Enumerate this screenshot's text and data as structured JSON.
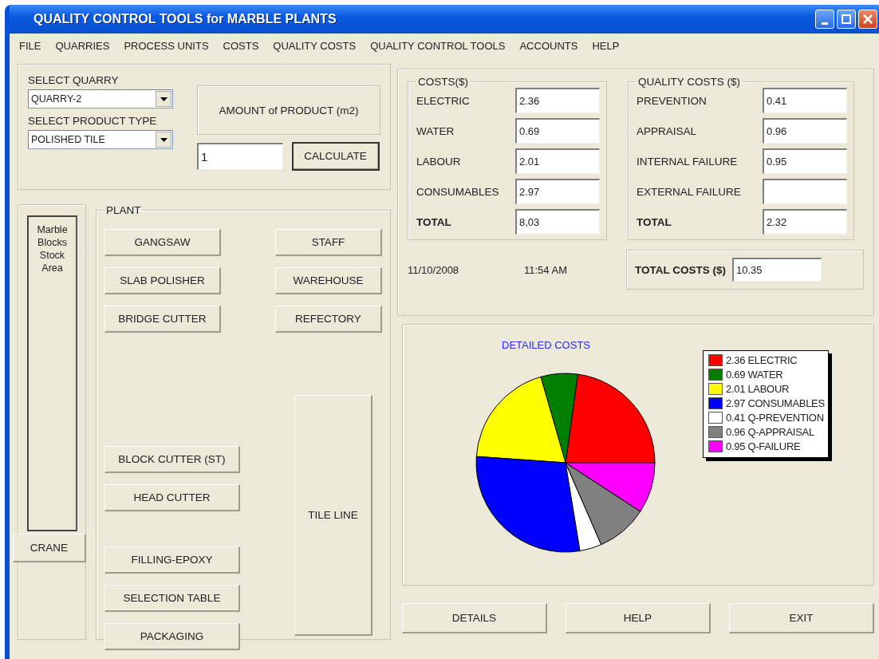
{
  "window": {
    "title": "QUALITY CONTROL TOOLS for MARBLE PLANTS"
  },
  "menu": [
    "FILE",
    "QUARRIES",
    "PROCESS UNITS",
    "COSTS",
    "QUALITY COSTS",
    "QUALITY CONTROL TOOLS",
    "ACCOUNTS",
    "HELP"
  ],
  "selection": {
    "quarry_label": "SELECT QUARRY",
    "quarry": "QUARRY-2",
    "product_label": "SELECT PRODUCT TYPE",
    "product": "POLISHED TILE",
    "amount_label": "AMOUNT of PRODUCT (m2)",
    "amount": "1",
    "calculate": "CALCULATE"
  },
  "stock_area": {
    "label": "Marble Blocks Stock Area",
    "crane": "CRANE"
  },
  "plant": {
    "title": "PLANT",
    "left_groups": [
      [
        "GANGSAW",
        "SLAB POLISHER",
        "BRIDGE CUTTER"
      ],
      [
        "BLOCK CUTTER (ST)",
        "HEAD CUTTER"
      ],
      [
        "FILLING-EPOXY",
        "SELECTION TABLE",
        "PACKAGING"
      ]
    ],
    "right_buttons": [
      "STAFF",
      "WAREHOUSE",
      "REFECTORY"
    ],
    "tile_line": "TILE LINE"
  },
  "costs": {
    "title": "COSTS($)",
    "rows": [
      {
        "label": "ELECTRIC",
        "value": "2.36",
        "bold": false
      },
      {
        "label": "WATER",
        "value": "0.69",
        "bold": false
      },
      {
        "label": "LABOUR",
        "value": "2.01",
        "bold": false
      },
      {
        "label": "CONSUMABLES",
        "value": "2.97",
        "bold": false
      },
      {
        "label": "TOTAL",
        "value": "8,03",
        "bold": true
      }
    ]
  },
  "quality_costs": {
    "title": "QUALITY COSTS ($)",
    "rows": [
      {
        "label": "PREVENTION",
        "value": "0.41",
        "bold": false
      },
      {
        "label": "APPRAISAL",
        "value": "0.96",
        "bold": false
      },
      {
        "label": "INTERNAL FAILURE",
        "value": "0.95",
        "bold": false
      },
      {
        "label": "EXTERNAL FAILURE",
        "bold": false
      },
      {
        "label": "TOTAL",
        "value": "2.32",
        "bold": true
      }
    ]
  },
  "status": {
    "date": "11/10/2008",
    "time": "11:54 AM",
    "total_label": "TOTAL COSTS ($)",
    "total": "10.35"
  },
  "chart": {
    "legend": [
      {
        "color": "#ff0000"
      },
      {
        "color": "#008000"
      },
      {
        "color": "#ffff00"
      },
      {
        "color": "#0000ff"
      },
      {
        "color": "#ffffff"
      },
      {
        "color": "#808080"
      },
      {
        "color": "#ff00ff"
      }
    ],
    "chart_data": {
      "type": "pie",
      "title": "DETAILED COSTS",
      "categories": [
        "2.36 ELECTRIC",
        "0.69 WATER",
        "2.01 LABOUR",
        "2.97 CONSUMABLES",
        "0.41 Q-PREVENTION",
        "0.96 Q-APPRAISAL",
        "0.95 Q-FAILURE"
      ],
      "values": [
        2.36,
        0.69,
        2.01,
        2.97,
        0.41,
        0.96,
        0.95
      ]
    }
  },
  "footer_buttons": [
    "DETAILS",
    "HELP",
    "EXIT"
  ]
}
